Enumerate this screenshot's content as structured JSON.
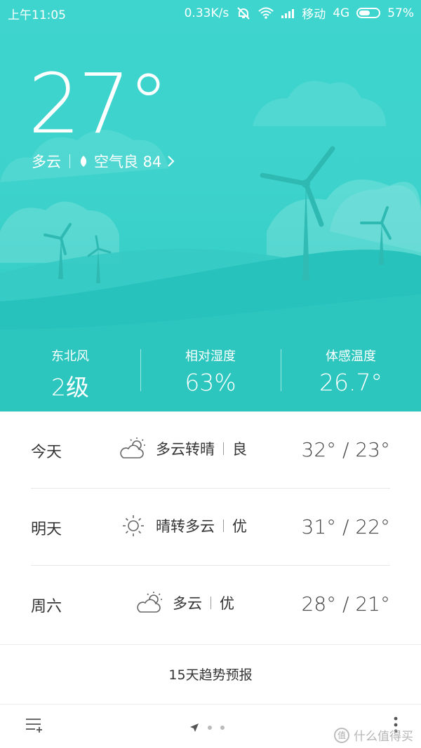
{
  "status_bar": {
    "time": "上午11:05",
    "speed": "0.33K/s",
    "carrier": "移动",
    "network": "4G",
    "battery": "57%",
    "battery_level": 0.57
  },
  "current": {
    "temperature": "27°",
    "condition": "多云",
    "air_quality": "空气良 84"
  },
  "stats": [
    {
      "label": "东北风",
      "value": "2级"
    },
    {
      "label": "相对湿度",
      "value": "63%"
    },
    {
      "label": "体感温度",
      "value": "26.7°"
    }
  ],
  "forecast": [
    {
      "day": "今天",
      "icon": "partly-cloudy-icon",
      "condition": "多云转晴",
      "aqi": "良",
      "temps": "32° / 23°"
    },
    {
      "day": "明天",
      "icon": "sun-icon",
      "condition": "晴转多云",
      "aqi": "优",
      "temps": "31° / 22°"
    },
    {
      "day": "周六",
      "icon": "partly-cloudy-icon",
      "condition": "多云",
      "aqi": "优",
      "temps": "28° / 21°"
    }
  ],
  "trend_label": "15天趋势预报",
  "watermark": "什么值得买",
  "colors": {
    "hero_top": "#3fd5cf",
    "hero_bottom": "#2fc9c2",
    "hill_front": "#22bdb6"
  }
}
